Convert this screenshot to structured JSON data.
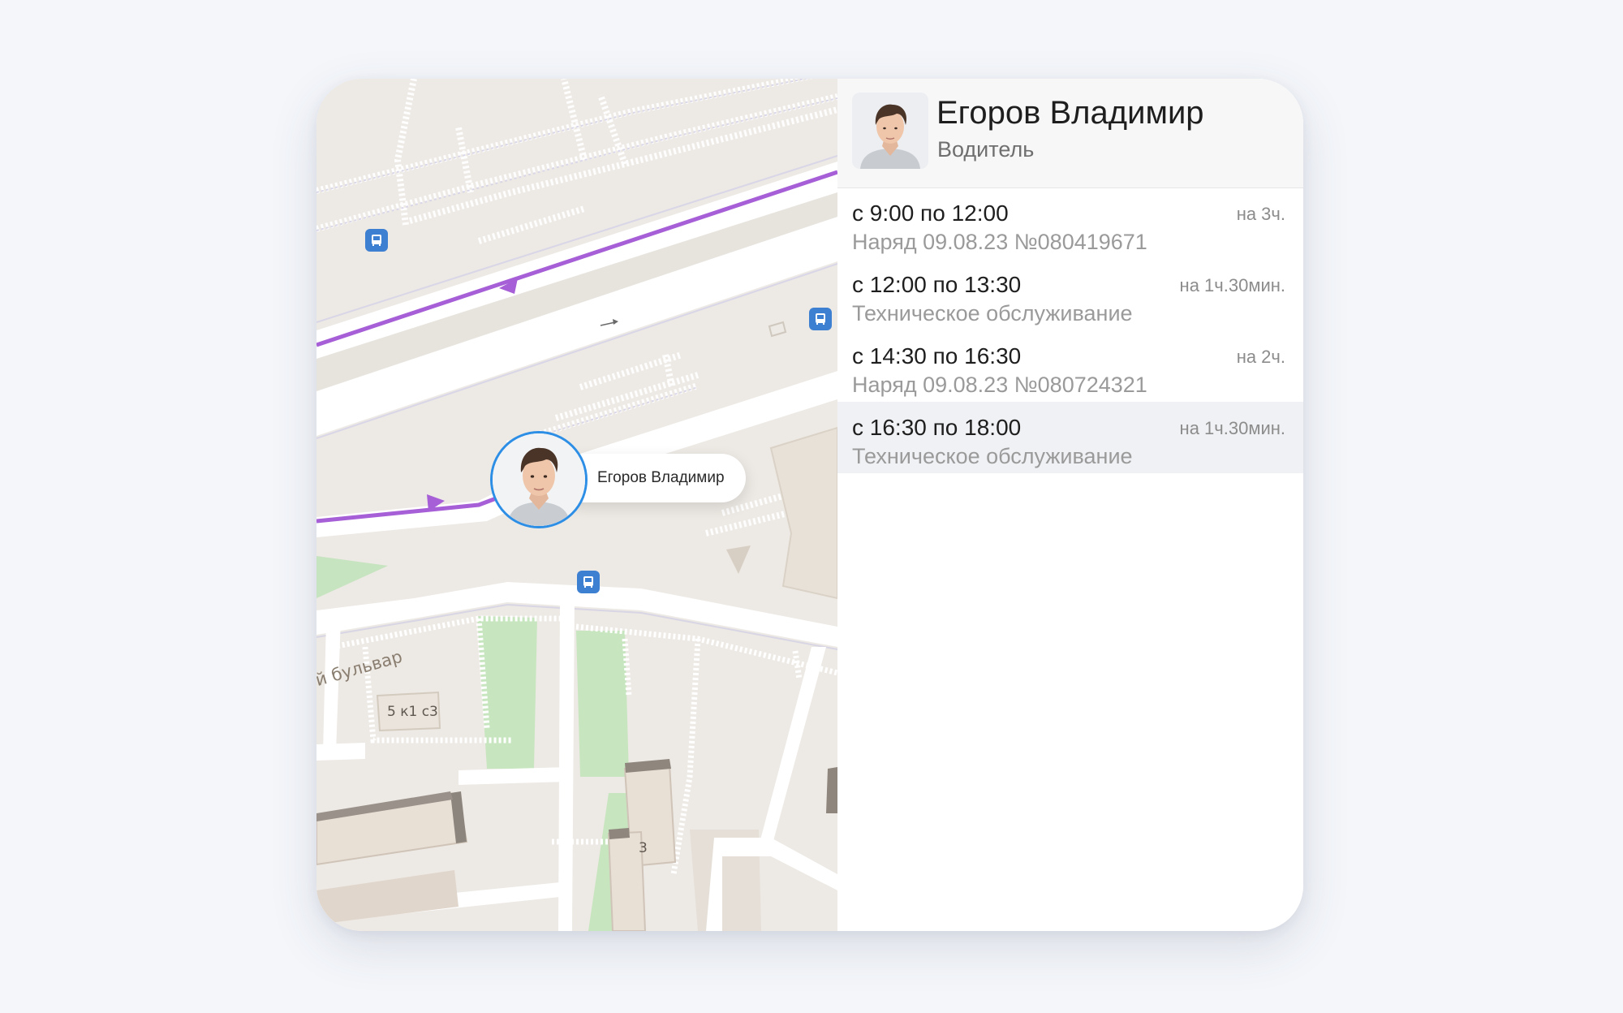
{
  "driver": {
    "name": "Егоров Владимир",
    "role": "Водитель"
  },
  "map": {
    "marker_label": "Егоров Владимир",
    "street_label": "й бульвар",
    "house_numbers": [
      "5 к1 с3",
      "3"
    ],
    "route_color": "#a65fd6",
    "marker_border_color": "#2d8ee6",
    "bus_stop_color": "#3d7fd0"
  },
  "schedule": [
    {
      "time": "с 9:00  по 12:00",
      "duration": "на 3ч.",
      "desc": "Наряд 09.08.23 №080419671",
      "highlighted": false
    },
    {
      "time": "с 12:00  по 13:30",
      "duration": "на 1ч.30мин.",
      "desc": "Техническое обслуживание",
      "highlighted": false
    },
    {
      "time": "с 14:30  по 16:30",
      "duration": "на 2ч.",
      "desc": "Наряд 09.08.23 №080724321",
      "highlighted": false
    },
    {
      "time": "с 16:30  по 18:00",
      "duration": "на 1ч.30мин.",
      "desc": "Техническое обслуживание",
      "highlighted": true
    }
  ]
}
